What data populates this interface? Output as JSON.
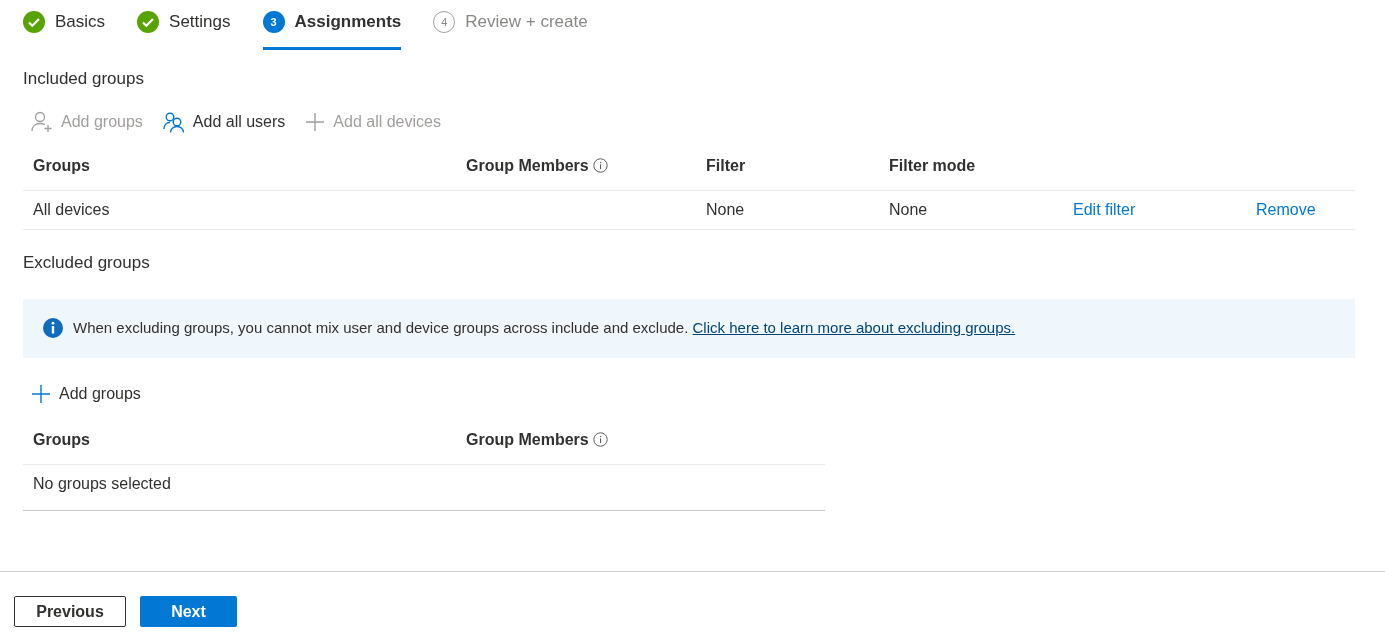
{
  "steps": [
    {
      "label": "Basics",
      "kind": "complete",
      "selected": false
    },
    {
      "label": "Settings",
      "kind": "complete",
      "selected": false
    },
    {
      "label": "Assignments",
      "kind": "current",
      "number": "3",
      "selected": true
    },
    {
      "label": "Review + create",
      "kind": "upcoming",
      "number": "4",
      "selected": false
    }
  ],
  "included": {
    "title": "Included groups",
    "actions": [
      {
        "label": "Add groups",
        "kind": "person-add",
        "disabled": true
      },
      {
        "label": "Add all users",
        "kind": "people",
        "disabled": false
      },
      {
        "label": "Add all devices",
        "kind": "plus",
        "disabled": true
      }
    ],
    "columns": [
      {
        "label": "Groups",
        "info": false
      },
      {
        "label": "Group Members",
        "info": true
      },
      {
        "label": "Filter",
        "info": false
      },
      {
        "label": "Filter mode",
        "info": false
      }
    ],
    "rows": [
      {
        "cells": [
          "All devices",
          null,
          "None",
          "None"
        ],
        "links": [
          "Edit filter",
          "Remove"
        ]
      }
    ]
  },
  "excluded": {
    "title": "Excluded groups",
    "notice": {
      "text": "When excluding groups, you cannot mix user and device groups across include and exclude.",
      "link": "Click here to learn more about excluding groups."
    },
    "actions": [
      {
        "label": "Add groups",
        "kind": "plus",
        "disabled": false
      }
    ],
    "columns": [
      {
        "label": "Groups",
        "info": false
      },
      {
        "label": "Group Members",
        "info": true
      }
    ],
    "empty": "No groups selected"
  },
  "footer": {
    "buttons": [
      {
        "label": "Previous",
        "primary": false
      },
      {
        "label": "Next",
        "primary": true
      }
    ]
  }
}
